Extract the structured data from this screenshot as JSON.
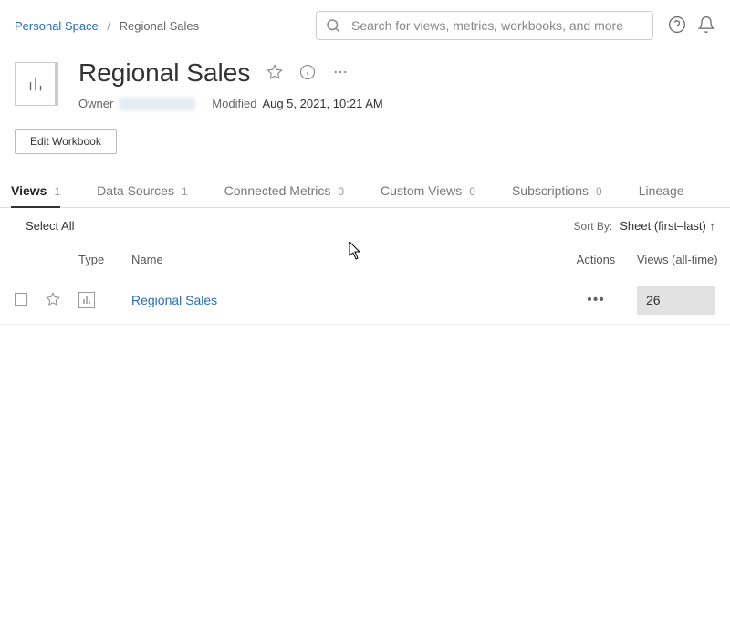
{
  "breadcrumb": {
    "parent": "Personal Space",
    "current": "Regional Sales"
  },
  "search": {
    "placeholder": "Search for views, metrics, workbooks, and more"
  },
  "header": {
    "title": "Regional Sales",
    "owner_label": "Owner",
    "modified_label": "Modified",
    "modified_value": "Aug 5, 2021, 10:21 AM"
  },
  "actions": {
    "edit_workbook": "Edit Workbook"
  },
  "tabs": [
    {
      "label": "Views",
      "count": "1",
      "active": true
    },
    {
      "label": "Data Sources",
      "count": "1",
      "active": false
    },
    {
      "label": "Connected Metrics",
      "count": "0",
      "active": false
    },
    {
      "label": "Custom Views",
      "count": "0",
      "active": false
    },
    {
      "label": "Subscriptions",
      "count": "0",
      "active": false
    },
    {
      "label": "Lineage",
      "count": "",
      "active": false
    }
  ],
  "toolbar": {
    "select_all": "Select All",
    "sort_by_label": "Sort By:",
    "sort_value": "Sheet (first–last) ↑"
  },
  "columns": {
    "type": "Type",
    "name": "Name",
    "actions": "Actions",
    "views": "Views (all-time)"
  },
  "rows": [
    {
      "name": "Regional Sales",
      "views": "26"
    }
  ]
}
